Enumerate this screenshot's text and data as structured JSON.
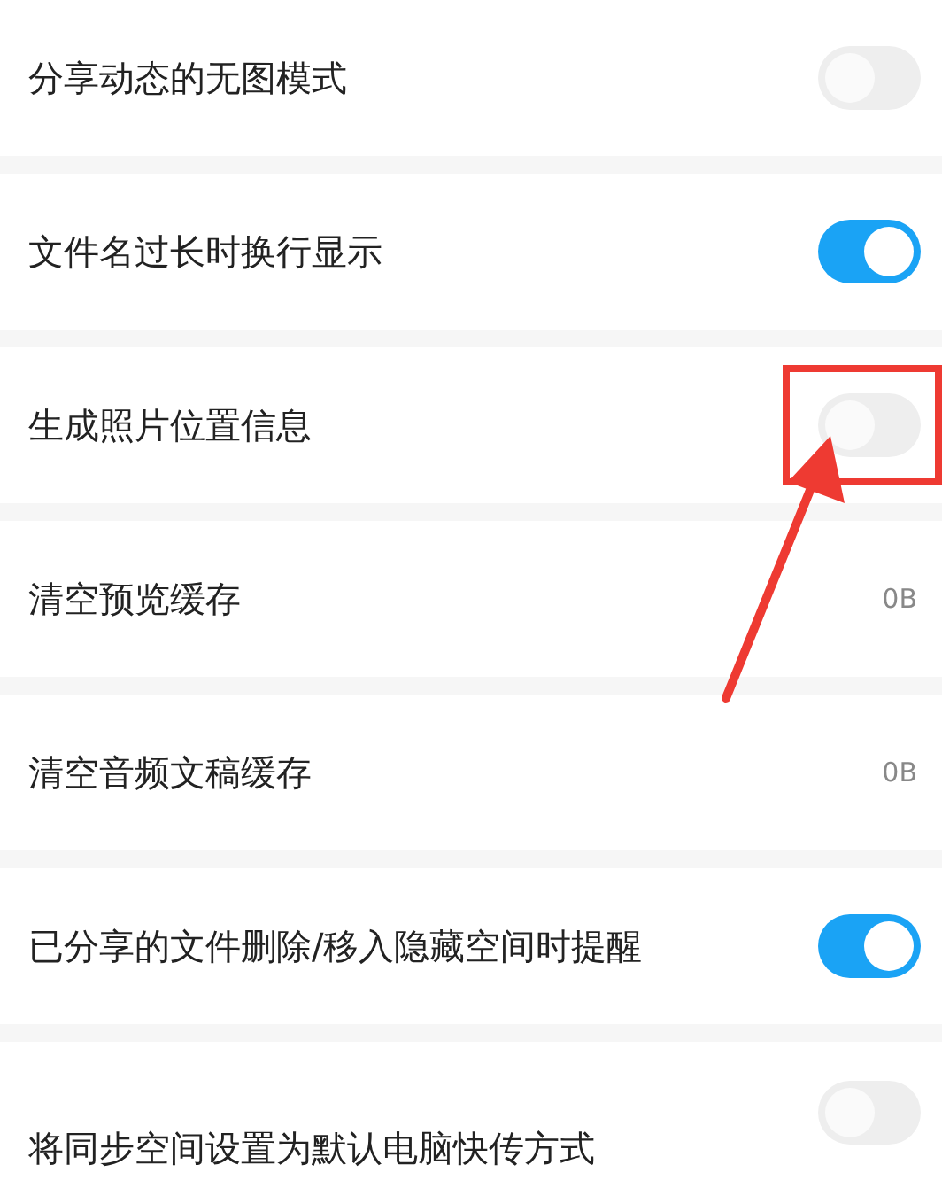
{
  "settings": [
    {
      "kind": "toggle",
      "label": "分享动态的无图模式",
      "on": false
    },
    {
      "kind": "toggle",
      "label": "文件名过长时换行显示",
      "on": true
    },
    {
      "kind": "toggle",
      "label": "生成照片位置信息",
      "on": false,
      "highlighted": true
    },
    {
      "kind": "value",
      "label": "清空预览缓存",
      "value": "0B"
    },
    {
      "kind": "value",
      "label": "清空音频文稿缓存",
      "value": "0B"
    },
    {
      "kind": "toggle",
      "label": "已分享的文件删除/移入隐藏空间时提醒",
      "on": true
    },
    {
      "kind": "toggle",
      "label": "将同步空间设置为默认电脑快传方式",
      "on": false
    }
  ]
}
